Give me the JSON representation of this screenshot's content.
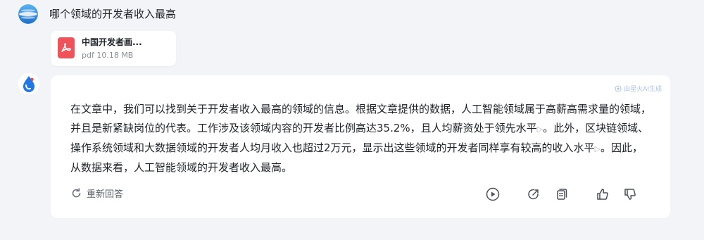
{
  "user": {
    "question": "哪个领域的开发者收入最高",
    "attachment": {
      "name": "中国开发者画...",
      "meta": "pdf 10.18 MB",
      "icon": "pdf-icon",
      "icon_color": "#f0525a"
    }
  },
  "answer": {
    "badge": "由星火AI生成",
    "segments": [
      "在文章中，我们可以找到关于开发者收入最高的领域的信息。根据文章提供的数据，人工智能领域属于高薪高需求量的领域，并且是新紧缺岗位的代表。工作涉及该领域内容的开发者比例高达35.2%，且人均薪资处于领先水平",
      "。此外，区块链领域、操作系统领域和大数据领域的开发者人均月收入也超过2万元，显示出这些领域的开发者同样享有较高的收入水平",
      "。因此，从数据来看，人工智能领域的开发者收入最高。"
    ],
    "footnote_mark": "▷",
    "regenerate_label": "重新回答",
    "actions": [
      "play-icon",
      "share-icon",
      "copy-icon",
      "thumbs-up-icon",
      "thumbs-down-icon"
    ]
  },
  "colors": {
    "background": "#f3f4f8",
    "card": "#ffffff",
    "text": "#1f2329",
    "muted": "#8a9099",
    "brand_blue": "#2f7cf6"
  }
}
